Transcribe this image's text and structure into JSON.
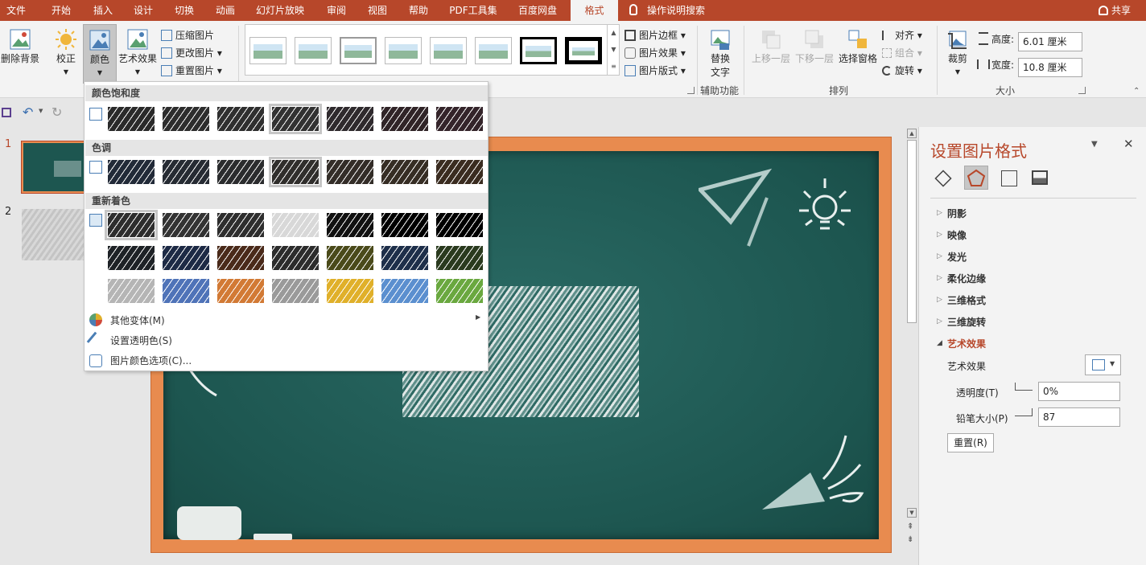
{
  "tabs": [
    {
      "label": "文件"
    },
    {
      "label": "开始"
    },
    {
      "label": "插入"
    },
    {
      "label": "设计"
    },
    {
      "label": "切换"
    },
    {
      "label": "动画"
    },
    {
      "label": "幻灯片放映"
    },
    {
      "label": "审阅"
    },
    {
      "label": "视图"
    },
    {
      "label": "帮助"
    },
    {
      "label": "PDF工具集"
    },
    {
      "label": "百度网盘"
    },
    {
      "label": "格式"
    }
  ],
  "search": {
    "label": "操作说明搜索"
  },
  "share": {
    "label": "共享"
  },
  "ribbon": {
    "remove_bg": "删除背景",
    "correct": "校正",
    "color": "颜色",
    "art_effects": "艺术效果",
    "compress": "压缩图片",
    "change_pic": "更改图片",
    "reset_pic": "重置图片",
    "pic_border": "图片边框",
    "pic_effects": "图片效果",
    "pic_layout": "图片版式",
    "alt_text_1": "替换",
    "alt_text_2": "文字",
    "accessibility": "辅助功能",
    "bring_forward": "上移一层",
    "send_backward": "下移一层",
    "selection_pane": "选择窗格",
    "align": "对齐",
    "group": "组合",
    "rotate": "旋转",
    "arrange": "排列",
    "crop": "裁剪",
    "height_label": "高度:",
    "height_value": "6.01 厘米",
    "width_label": "宽度:",
    "width_value": "10.8 厘米",
    "size_group": "大小"
  },
  "slides": [
    {
      "number": "1"
    },
    {
      "number": "2"
    }
  ],
  "color_menu": {
    "saturation_header": "颜色饱和度",
    "tone_header": "色调",
    "recolor_header": "重新着色",
    "more_variants": "其他变体(M)",
    "set_transparent": "设置透明色(S)",
    "color_options": "图片颜色选项(C)...",
    "saturation_colors": [
      "#2a2a2a",
      "#2d2d2d",
      "#2f2f2f",
      "#323232",
      "#2f2a2d",
      "#302427",
      "#34242a"
    ],
    "tone_colors": [
      "#222a38",
      "#262b33",
      "#2b2c2e",
      "#302e2c",
      "#332d28",
      "#362d24",
      "#3a2c20"
    ],
    "recolor_rows": [
      [
        "#2d2d2d",
        "#333333",
        "#2e2e2e",
        "#d8d8d8",
        "#111111",
        "#000000",
        "#000000"
      ],
      [
        "#1e2226",
        "#1d2a45",
        "#4a2a1a",
        "#2c2c2c",
        "#4a4a1a",
        "#1e2f4a",
        "#2a3a1e"
      ],
      [
        "#b5b5b5",
        "#4f73b8",
        "#d27a35",
        "#9a9a9a",
        "#e0b02a",
        "#5b8fcf",
        "#6aa83f"
      ]
    ]
  },
  "format_pane": {
    "title": "设置图片格式",
    "sections": [
      "阴影",
      "映像",
      "发光",
      "柔化边缘",
      "三维格式",
      "三维旋转"
    ],
    "active_section": "艺术效果",
    "art_effect_label": "艺术效果",
    "transparency_label": "透明度(T)",
    "transparency_value": "0%",
    "pencil_size_label": "铅笔大小(P)",
    "pencil_size_value": "87",
    "reset_button": "重置(R)"
  },
  "colors": {
    "accent": "#b7472a",
    "board": "#1d5650",
    "frame": "#e88b4f"
  }
}
